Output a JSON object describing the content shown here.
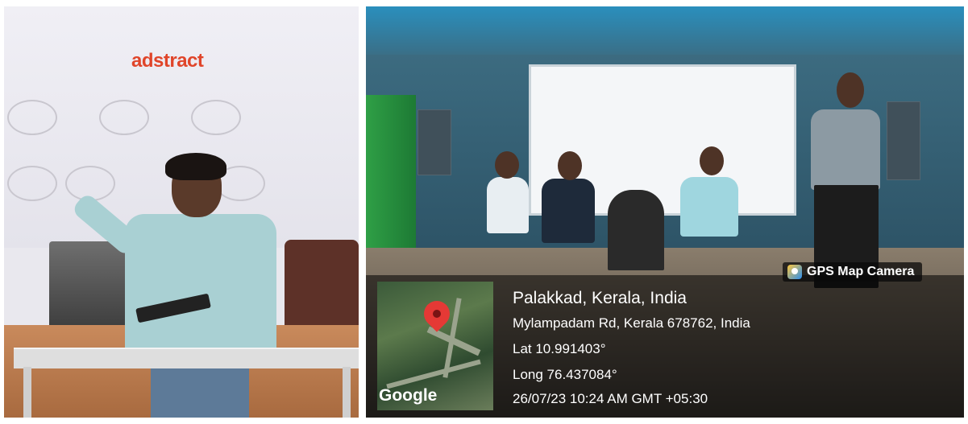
{
  "left_photo": {
    "logo": "adstract"
  },
  "right_photo": {
    "badge": "GPS Map Camera",
    "map_brand": "Google",
    "location": {
      "title": "Palakkad, Kerala, India",
      "address": "Mylampadam Rd, Kerala 678762, India",
      "lat": "Lat 10.991403°",
      "long": "Long 76.437084°",
      "datetime": "26/07/23 10:24 AM GMT +05:30"
    }
  },
  "colors": {
    "logo": "#e0452a",
    "map_pin": "#e53935",
    "overlay_text": "#ffffff"
  }
}
